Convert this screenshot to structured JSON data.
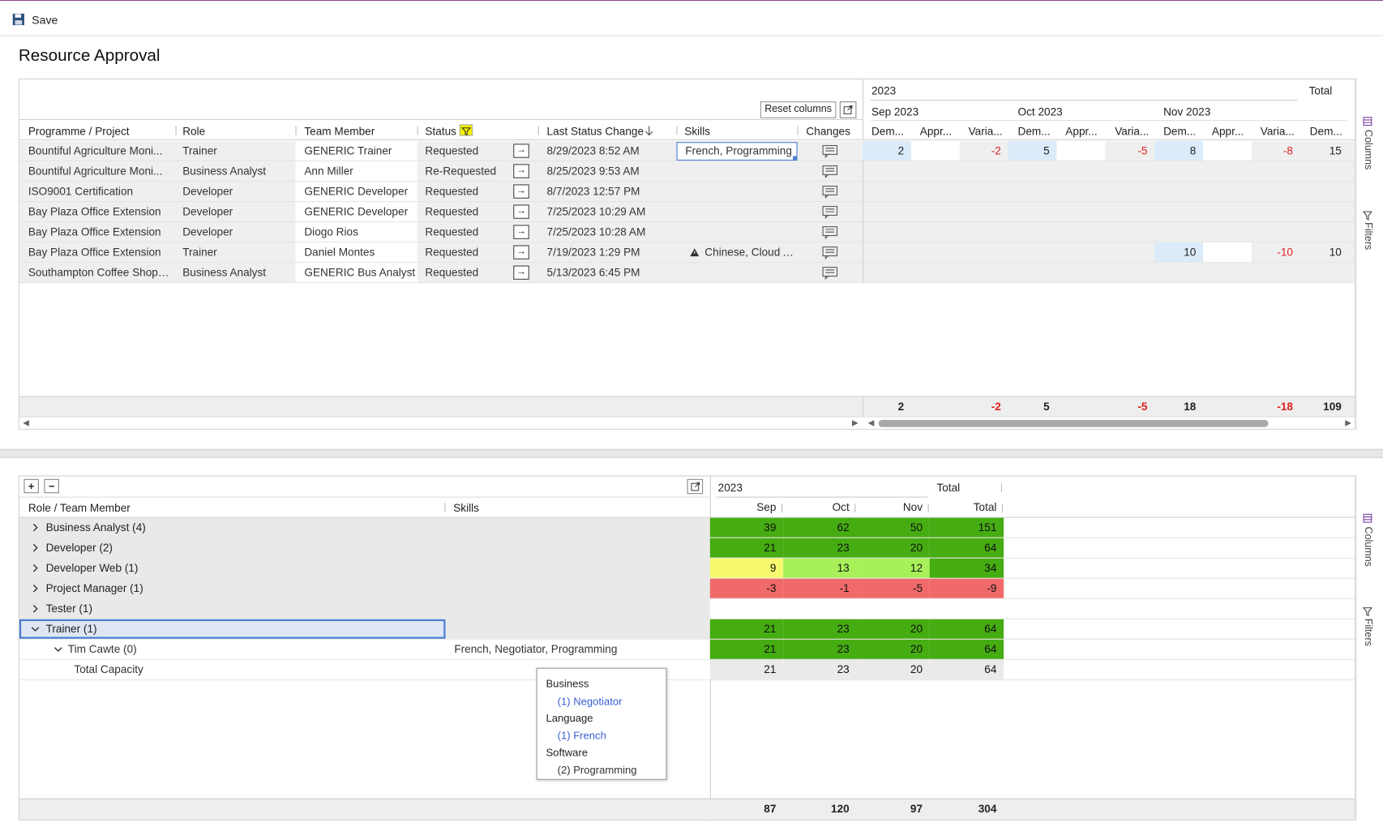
{
  "toolbar": {
    "save_label": "Save"
  },
  "page_title": "Resource Approval",
  "grid1": {
    "reset_columns": "Reset columns",
    "columns": {
      "programme": "Programme / Project",
      "role": "Role",
      "team_member": "Team Member",
      "status": "Status",
      "last_status_change": "Last Status Change",
      "skills": "Skills",
      "changes": "Changes"
    },
    "period": {
      "year": "2023",
      "total": "Total",
      "months": [
        "Sep 2023",
        "Oct 2023",
        "Nov 2023"
      ],
      "sub": [
        "Dem...",
        "Appr...",
        "Varia..."
      ],
      "total_sub": "Dem..."
    },
    "rows": [
      {
        "programme": "Bountiful Agriculture Moni...",
        "role": "Trainer",
        "member": "GENERIC Trainer",
        "status": "Requested",
        "change": "8/29/2023 8:52 AM",
        "skills": "French, Programming",
        "warn": false,
        "sep_dem": "2",
        "sep_var": "-2",
        "oct_dem": "5",
        "oct_var": "-5",
        "nov_dem": "8",
        "nov_var": "-8",
        "total": "15"
      },
      {
        "programme": "Bountiful Agriculture Moni...",
        "role": "Business Analyst",
        "member": "Ann Miller",
        "status": "Re-Requested",
        "change": "8/25/2023 9:53 AM",
        "skills": "",
        "warn": false
      },
      {
        "programme": "ISO9001 Certification",
        "role": "Developer",
        "member": "GENERIC Developer",
        "status": "Requested",
        "change": "8/7/2023 12:57 PM",
        "skills": "",
        "warn": false
      },
      {
        "programme": "Bay Plaza Office Extension",
        "role": "Developer",
        "member": "GENERIC Developer",
        "status": "Requested",
        "change": "7/25/2023 10:29 AM",
        "skills": "",
        "warn": false
      },
      {
        "programme": "Bay Plaza Office Extension",
        "role": "Developer",
        "member": "Diogo Rios",
        "status": "Requested",
        "change": "7/25/2023 10:28 AM",
        "skills": "",
        "warn": false
      },
      {
        "programme": "Bay Plaza Office Extension",
        "role": "Trainer",
        "member": "Daniel Montes",
        "status": "Requested",
        "change": "7/19/2023 1:29 PM",
        "skills": "Chinese, Cloud Arch",
        "warn": true,
        "nov_dem": "10",
        "nov_var": "-10",
        "total": "10"
      },
      {
        "programme": "Southampton Coffee Shop ...",
        "role": "Business Analyst",
        "member": "GENERIC Bus Analyst",
        "status": "Requested",
        "change": "5/13/2023 6:45 PM",
        "skills": "",
        "warn": false
      }
    ],
    "totals": {
      "sep_dem": "2",
      "sep_var": "-2",
      "oct_dem": "5",
      "oct_var": "-5",
      "nov_dem": "18",
      "nov_var": "-18",
      "total": "109"
    }
  },
  "side": {
    "columns": "Columns",
    "filters": "Filters"
  },
  "grid2": {
    "columns": {
      "role": "Role / Team Member",
      "skills": "Skills"
    },
    "year": "2023",
    "total": "Total",
    "months": [
      "Sep",
      "Oct",
      "Nov",
      "Total"
    ],
    "rows": [
      {
        "label": "Business Analyst (4)",
        "vals": [
          "39",
          "62",
          "50",
          "151"
        ]
      },
      {
        "label": "Developer (2)",
        "vals": [
          "21",
          "23",
          "20",
          "64"
        ]
      },
      {
        "label": "Developer Web (1)",
        "vals": [
          "9",
          "13",
          "12",
          "34"
        ]
      },
      {
        "label": "Project Manager (1)",
        "vals": [
          "-3",
          "-1",
          "-5",
          "-9"
        ]
      },
      {
        "label": "Tester (1)",
        "vals": [
          "",
          "",
          "",
          ""
        ]
      },
      {
        "label": "Trainer (1)",
        "vals": [
          "21",
          "23",
          "20",
          "64"
        ]
      },
      {
        "label": "Tim Cawte (0)",
        "skills": "French, Negotiator, Programming",
        "vals": [
          "21",
          "23",
          "20",
          "64"
        ]
      },
      {
        "label": "Total Capacity",
        "vals": [
          "21",
          "23",
          "20",
          "64"
        ]
      }
    ],
    "totals": [
      "87",
      "120",
      "97",
      "304"
    ]
  },
  "tooltip": {
    "groups": [
      {
        "name": "Business",
        "item": "(1) Negotiator"
      },
      {
        "name": "Language",
        "item": "(1) French"
      },
      {
        "name": "Software",
        "item": "(2) Programming"
      }
    ]
  }
}
